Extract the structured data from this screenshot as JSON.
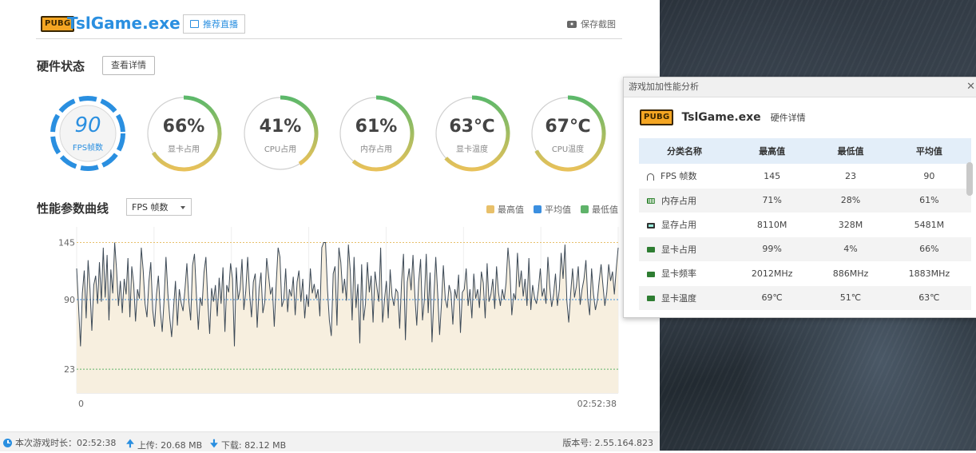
{
  "app": {
    "logo_text": "PUBG",
    "title": "TslGame.exe",
    "live_label": "推荐直播",
    "screenshot_label": "保存截图"
  },
  "hardware": {
    "title": "硬件状态",
    "detail_button": "查看详情",
    "gauges": [
      {
        "value": "90",
        "label": "FPS帧数",
        "fraction": 1.0,
        "style": "fps"
      },
      {
        "value": "66%",
        "label": "显卡占用",
        "fraction": 0.66
      },
      {
        "value": "41%",
        "label": "CPU占用",
        "fraction": 0.41
      },
      {
        "value": "61%",
        "label": "内存占用",
        "fraction": 0.61
      },
      {
        "value": "63℃",
        "label": "显卡温度",
        "fraction": 0.63
      },
      {
        "value": "67℃",
        "label": "CPU温度",
        "fraction": 0.67
      }
    ]
  },
  "curve": {
    "title": "性能参数曲线",
    "selected_metric": "FPS 帧数",
    "legend": [
      {
        "label": "最高值",
        "color": "#e8c06a"
      },
      {
        "label": "平均值",
        "color": "#3b8fe0"
      },
      {
        "label": "最低值",
        "color": "#5fb36a"
      }
    ]
  },
  "chart_data": {
    "type": "area",
    "xlabel": "",
    "ylabel": "",
    "x_start_label": "0",
    "x_end_label": "02:52:38",
    "y_ticks": [
      145,
      90,
      23
    ],
    "ylim": [
      0,
      160
    ],
    "reference_lines": {
      "max": 145,
      "avg": 90,
      "min": 23
    },
    "series": [
      {
        "values": [
          120,
          83,
          45,
          96,
          118,
          72,
          128,
          100,
          60,
          104,
          113,
          86,
          126,
          88,
          140,
          92,
          133,
          70,
          119,
          96,
          145,
          118,
          84,
          108,
          77,
          110,
          95,
          130,
          73,
          122,
          105,
          69,
          100,
          91,
          140,
          118,
          86,
          73,
          107,
          126,
          80,
          64,
          95,
          113,
          80,
          59,
          89,
          131,
          96,
          72,
          54,
          82,
          108,
          65,
          100,
          87,
          79,
          100,
          125,
          89,
          70,
          123,
          134,
          95,
          61,
          92,
          84,
          116,
          131,
          90,
          57,
          101,
          88,
          104,
          74,
          111,
          86,
          121,
          59,
          104,
          97,
          125,
          110,
          45,
          121,
          90,
          100,
          129,
          80,
          98,
          131,
          96,
          73,
          107,
          115,
          63,
          101,
          116,
          77,
          88,
          130,
          113,
          95,
          102,
          64,
          105,
          140,
          131,
          83,
          90,
          120,
          78,
          100,
          93,
          112,
          75,
          107,
          118,
          88,
          110,
          72,
          95,
          83,
          120,
          96,
          105,
          91,
          100,
          74,
          140,
          145,
          145,
          100,
          70,
          55,
          115,
          122,
          65,
          140,
          126,
          96,
          110,
          89,
          143,
          117,
          70,
          131,
          82,
          105,
          48,
          124,
          70,
          86,
          126,
          97,
          113,
          68,
          117,
          102,
          88,
          140,
          68,
          90,
          108,
          72,
          119,
          93,
          84,
          100,
          97,
          62,
          107,
          134,
          51,
          107,
          120,
          99,
          133,
          93,
          65,
          107,
          129,
          70,
          90,
          134,
          77,
          116,
          49,
          92,
          131,
          96,
          56,
          87,
          123,
          91,
          82,
          104,
          96,
          66,
          100,
          91,
          114,
          58,
          97,
          100,
          120,
          84,
          100,
          72,
          115,
          91,
          100,
          82,
          117,
          106,
          72,
          125,
          88,
          95,
          110,
          81,
          122,
          97,
          84,
          100,
          90,
          106,
          140,
          118,
          75,
          96,
          90,
          135,
          102,
          118,
          93,
          110,
          84,
          130,
          80,
          104,
          92,
          86,
          100,
          120,
          93,
          101,
          86,
          131,
          102,
          83,
          95,
          115,
          84,
          100,
          135,
          110,
          143,
          88,
          68,
          96,
          120,
          92,
          103,
          122,
          85,
          100,
          110,
          128,
          91,
          75,
          120,
          95,
          80,
          89,
          108,
          124,
          103,
          84,
          97,
          124,
          108,
          117,
          95,
          120,
          140
        ]
      }
    ]
  },
  "status": {
    "duration": "本次游戏时长：02:52:38",
    "upload": "上传: 20.68 MB",
    "download": "下载: 82.12 MB",
    "version": "版本号: 2.55.164.823"
  },
  "popup": {
    "title": "游戏加加性能分析",
    "app_name": "TslGame.exe",
    "app_sub": "硬件详情",
    "headers": [
      "分类名称",
      "最高值",
      "最低值",
      "平均值"
    ],
    "rows": [
      {
        "icon": "fps",
        "name": "FPS 帧数",
        "max": "145",
        "min": "23",
        "avg": "90"
      },
      {
        "icon": "mem",
        "name": "内存占用",
        "max": "71%",
        "min": "28%",
        "avg": "61%"
      },
      {
        "icon": "vmem",
        "name": "显存占用",
        "max": "8110M",
        "min": "328M",
        "avg": "5481M"
      },
      {
        "icon": "gpu",
        "name": "显卡占用",
        "max": "99%",
        "min": "4%",
        "avg": "66%"
      },
      {
        "icon": "gpu",
        "name": "显卡频率",
        "max": "2012MHz",
        "min": "886MHz",
        "avg": "1883MHz"
      },
      {
        "icon": "gpu",
        "name": "显卡温度",
        "max": "69℃",
        "min": "51℃",
        "avg": "63℃"
      }
    ]
  }
}
